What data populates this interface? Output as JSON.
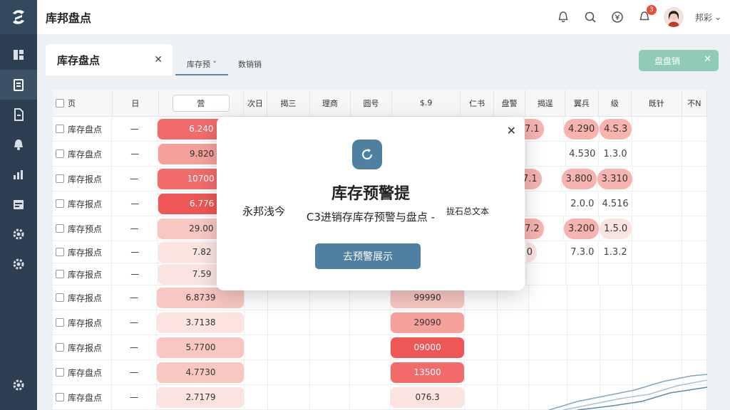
{
  "app": {
    "title": "库邦盘点"
  },
  "header": {
    "badge_count": "3",
    "user_name": "邦彩"
  },
  "tabs": {
    "main": "库存盘点",
    "second": "库存预",
    "third": "数销销",
    "right_button": "盘盘销"
  },
  "table": {
    "headers": [
      "页",
      "日",
      "营",
      "次日",
      "揭三",
      "理商",
      "圆号",
      "$.9",
      "仁书",
      "盘警",
      "揭逞",
      "翼兵",
      "级",
      "既针",
      "不N"
    ],
    "rows": [
      {
        "name": "库存盘点",
        "dash": "—",
        "amount": "6.240",
        "mid": "",
        "c10": "7.1",
        "c11": "4.290",
        "c12": "4.S.3"
      },
      {
        "name": "库存盘点",
        "dash": "—",
        "amount": "9.820",
        "mid": "",
        "c10": "",
        "c11": "4.530",
        "c12": "1.3.0"
      },
      {
        "name": "库存报点",
        "dash": "—",
        "amount": "10700",
        "mid": "",
        "c10": "7.1",
        "c11": "3.800",
        "c12": "3.310"
      },
      {
        "name": "库存报点",
        "dash": "—",
        "amount": "6.776",
        "mid": "",
        "c10": "",
        "c11": "2.0.0",
        "c12": "4.516"
      },
      {
        "name": "库存预点",
        "dash": "—",
        "amount": "29.00",
        "mid": "",
        "c10": "7.2",
        "c11": "3.200",
        "c12": "1.5.0"
      },
      {
        "name": "库存报点",
        "dash": "—",
        "amount": "7.82",
        "mid": "",
        "c10": "0",
        "c11": "7.3.0",
        "c12": "1.3.2"
      },
      {
        "name": "库存报点",
        "dash": "—",
        "amount": "7.59",
        "mid": "",
        "c10": "",
        "c11": "",
        "c12": ""
      },
      {
        "name": "库存报点",
        "dash": "—",
        "amount": "6.8739",
        "mid": "99990",
        "c10": "",
        "c11": "",
        "c12": ""
      },
      {
        "name": "库存报点",
        "dash": "—",
        "amount": "3.7138",
        "mid": "29090",
        "c10": "",
        "c11": "",
        "c12": ""
      },
      {
        "name": "库存报点",
        "dash": "—",
        "amount": "5.7700",
        "mid": "09000",
        "c10": "",
        "c11": "",
        "c12": ""
      },
      {
        "name": "库存盘点",
        "dash": "—",
        "amount": "4.7730",
        "mid": "13500",
        "c10": "",
        "c11": "",
        "c12": ""
      },
      {
        "name": "库存盘点",
        "dash": "—",
        "amount": "2.7179",
        "mid": "076.3",
        "c10": "",
        "c11": "",
        "c12": ""
      }
    ]
  },
  "modal": {
    "title": "库存预警提",
    "description": "C3进销存库存预警与盘点 -",
    "left_text": "永邦浅今",
    "right_text": "拢石总文本",
    "button": "去预警展示"
  },
  "colors": {
    "sidebar": "#2c3e50",
    "accent": "#4f7fa1",
    "danger": "#f26b6b",
    "success": "#8fcbb7"
  }
}
